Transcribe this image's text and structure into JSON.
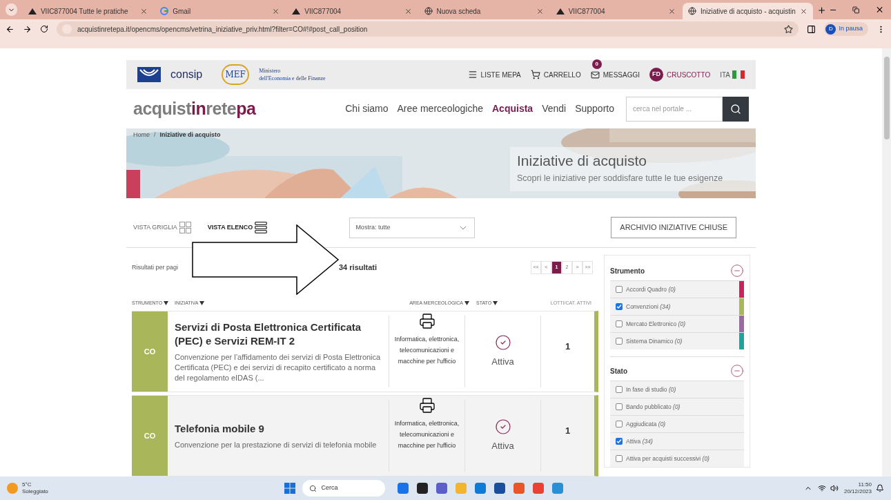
{
  "browser": {
    "tabs": [
      {
        "title": "VIIC877004 Tutte le pratiche",
        "kind": "cloud",
        "selected": false
      },
      {
        "title": "Gmail",
        "kind": "google",
        "selected": false
      },
      {
        "title": "VIIC877004",
        "kind": "cloud",
        "selected": false
      },
      {
        "title": "Nuova scheda",
        "kind": "globe",
        "selected": false
      },
      {
        "title": "VIIC877004",
        "kind": "cloud",
        "selected": false
      },
      {
        "title": "Iniziative di acquisto - acquistin",
        "kind": "globe",
        "selected": true
      }
    ],
    "url": "acquistinretepa.it/opencms/opencms/vetrina_iniziative_priv.html?filter=CO#!#post_call_position",
    "profile": {
      "initial": "D",
      "label": "In pausa"
    }
  },
  "topbar": {
    "consip": "consip",
    "mef": "MEF",
    "ministry_line1": "Ministero",
    "ministry_line2": "dell'Economia e delle Finanze",
    "links": [
      {
        "label": "LISTE MEPA",
        "kind": "menu"
      },
      {
        "label": "CARRELLO",
        "kind": "cart"
      },
      {
        "label": "MESSAGGI",
        "kind": "mail",
        "badge": "0"
      }
    ],
    "user": {
      "initials": "FD",
      "label": "CRUSCOTTO"
    },
    "language": "ITA"
  },
  "nav": {
    "brand": [
      {
        "text": "acquist",
        "accent": false
      },
      {
        "text": "in",
        "accent": true
      },
      {
        "text": "rete",
        "accent": false
      },
      {
        "text": "pa",
        "accent": true
      }
    ],
    "menu": [
      {
        "label": "Chi siamo",
        "selected": false
      },
      {
        "label": "Aree merceologiche",
        "selected": false
      },
      {
        "label": "Acquista",
        "selected": true
      },
      {
        "label": "Vendi",
        "selected": false
      },
      {
        "label": "Supporto",
        "selected": false
      }
    ],
    "search_placeholder": "cerca nel portale ..."
  },
  "breadcrumb": {
    "home": "Home",
    "separator": "/",
    "current": "Iniziative di acquisto"
  },
  "banner": {
    "title": "Iniziative di acquisto",
    "subtitle": "Scopri le iniziative per soddisfare tutte le tue esigenze"
  },
  "toolbar": {
    "views": [
      {
        "label": "VISTA GRIGLIA",
        "kind": "grid",
        "selected": false
      },
      {
        "label": "VISTA ELENCO",
        "kind": "list",
        "selected": true
      }
    ],
    "filter_select": "Mostra: tutte",
    "archive_button": "ARCHIVIO INIZIATIVE CHIUSE"
  },
  "results": {
    "per_page_label": "Risultati per pagi",
    "count": "34 risultati",
    "pagination": [
      {
        "label": "<<",
        "selected": false
      },
      {
        "label": "<",
        "selected": false
      },
      {
        "label": "1",
        "selected": true
      },
      {
        "label": "2",
        "selected": false
      },
      {
        "label": ">",
        "selected": false
      },
      {
        "label": ">>",
        "selected": false
      }
    ]
  },
  "table": {
    "columns": [
      {
        "label": "STRUMENTO",
        "sortable": true
      },
      {
        "label": "INIZIATIVA",
        "sortable": true
      },
      {
        "label": "AREA MERCEOLOGICA",
        "sortable": true
      },
      {
        "label": "STATO",
        "sortable": true
      },
      {
        "label": "LOTTI/CAT. ATTIVI",
        "sortable": false
      }
    ],
    "rows": [
      {
        "code": "CO",
        "title": "Servizi di Posta Elettronica Certificata (PEC) e Servizi REM-IT 2",
        "description": "Convenzione per l’affidamento dei servizi di Posta Elettronica Certificata (PEC) e dei servizi di recapito certificato a norma del regolamento eIDAS (...",
        "area": "Informatica, elettronica, telecomunicazioni e macchine per l'ufficio",
        "status": "Attiva",
        "lots": "1"
      },
      {
        "code": "CO",
        "title": "Telefonia mobile 9",
        "description": "Convenzione per la prestazione di servizi di telefonia mobile",
        "area": "Informatica, elettronica, telecomunicazioni e macchine per l'ufficio",
        "status": "Attiva",
        "lots": "1"
      }
    ]
  },
  "filters": [
    {
      "title": "Strumento",
      "items": [
        {
          "label": "Accordi Quadro *(0)*",
          "checked": false,
          "color": "#c8245e"
        },
        {
          "label": "Convenzioni *(34)*",
          "checked": true,
          "color": "#a9b65a"
        },
        {
          "label": "Mercato Elettronico *(0)*",
          "checked": false,
          "color": "#9a68a4"
        },
        {
          "label": "Sistema Dinamico *(0)*",
          "checked": false,
          "color": "#20a39a"
        }
      ]
    },
    {
      "title": "Stato",
      "items": [
        {
          "label": "In fase di studio *(0)*",
          "checked": false
        },
        {
          "label": "Bando pubblicato *(0)*",
          "checked": false
        },
        {
          "label": "Aggiudicata *(0)*",
          "checked": false
        },
        {
          "label": "Attiva *(34)*",
          "checked": true
        },
        {
          "label": "Attiva per acquisti successivi *(0)*",
          "checked": false
        }
      ]
    }
  ],
  "taskbar": {
    "temperature": "5°C",
    "weather": "Soleggiato",
    "search_placeholder": "Cerca",
    "time": "11:50",
    "date": "20/12/2023"
  }
}
